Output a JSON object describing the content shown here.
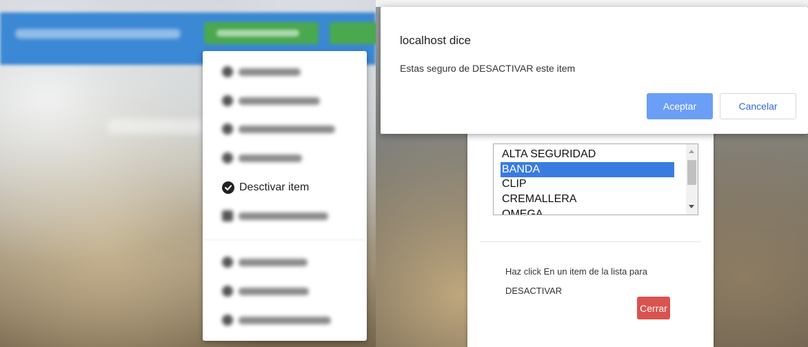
{
  "dropdown": {
    "active_item_label": "Desctivar item",
    "active_item_icon": "check-circle-icon"
  },
  "alert": {
    "title": "localhost dice",
    "message": "Estas seguro de DESACTIVAR este item",
    "accept_label": "Aceptar",
    "cancel_label": "Cancelar",
    "accept_color": "#6b9ef6"
  },
  "modal": {
    "list_options": [
      "ALTA SEGURIDAD",
      "BANDA",
      "CLIP",
      "CREMALLERA",
      "OMEGA"
    ],
    "selected_option": "BANDA",
    "instruction_line1": "Haz click En un item de la lista para",
    "instruction_line2": "DESACTIVAR",
    "close_label": "Cerrar",
    "close_color": "#d9534f",
    "selection_color": "#3a7be2"
  },
  "colors": {
    "navbar": "#3b88d4",
    "nav_button": "#4aa84f"
  }
}
